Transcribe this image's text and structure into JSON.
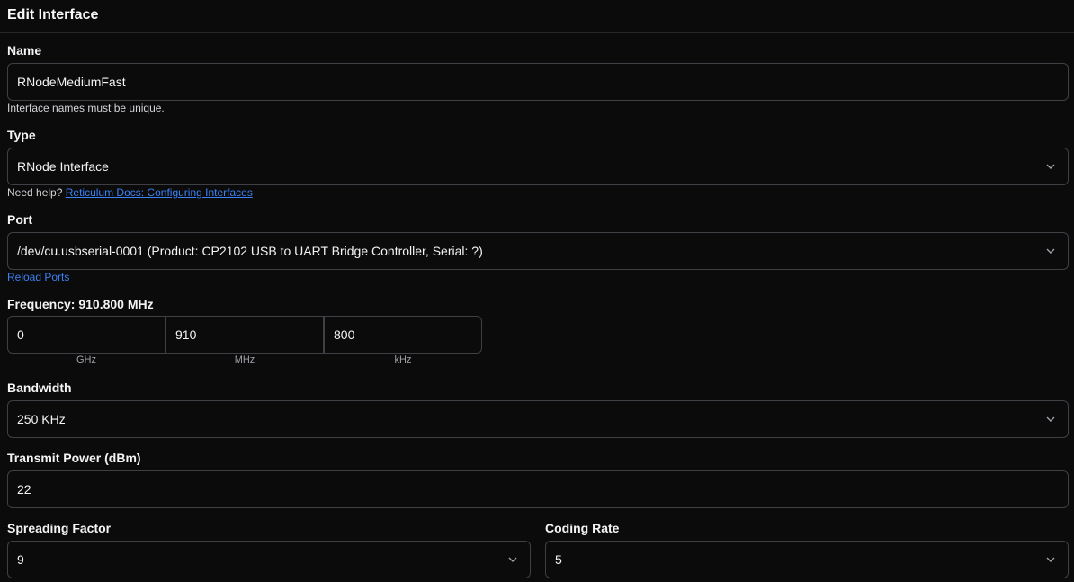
{
  "header": {
    "title": "Edit Interface"
  },
  "name": {
    "label": "Name",
    "value": "RNodeMediumFast",
    "hint": "Interface names must be unique."
  },
  "type": {
    "label": "Type",
    "value": "RNode Interface",
    "help_prefix": "Need help?",
    "help_link": "Reticulum Docs: Configuring Interfaces"
  },
  "port": {
    "label": "Port",
    "value": "/dev/cu.usbserial-0001 (Product: CP2102 USB to UART Bridge Controller, Serial: ?)",
    "reload_link": "Reload Ports"
  },
  "frequency": {
    "label": "Frequency: 910.800 MHz",
    "ghz": {
      "value": "0",
      "unit": "GHz"
    },
    "mhz": {
      "value": "910",
      "unit": "MHz"
    },
    "khz": {
      "value": "800",
      "unit": "kHz"
    }
  },
  "bandwidth": {
    "label": "Bandwidth",
    "value": "250 KHz"
  },
  "transmit_power": {
    "label": "Transmit Power (dBm)",
    "value": "22"
  },
  "spreading_factor": {
    "label": "Spreading Factor",
    "value": "9"
  },
  "coding_rate": {
    "label": "Coding Rate",
    "value": "5"
  },
  "icons": {
    "select_chevron": "chevron-down-icon"
  },
  "colors": {
    "background": "#0b0b0c",
    "border": "#3f3f46",
    "link": "#3b82f6",
    "text": "#f4f4f5"
  }
}
